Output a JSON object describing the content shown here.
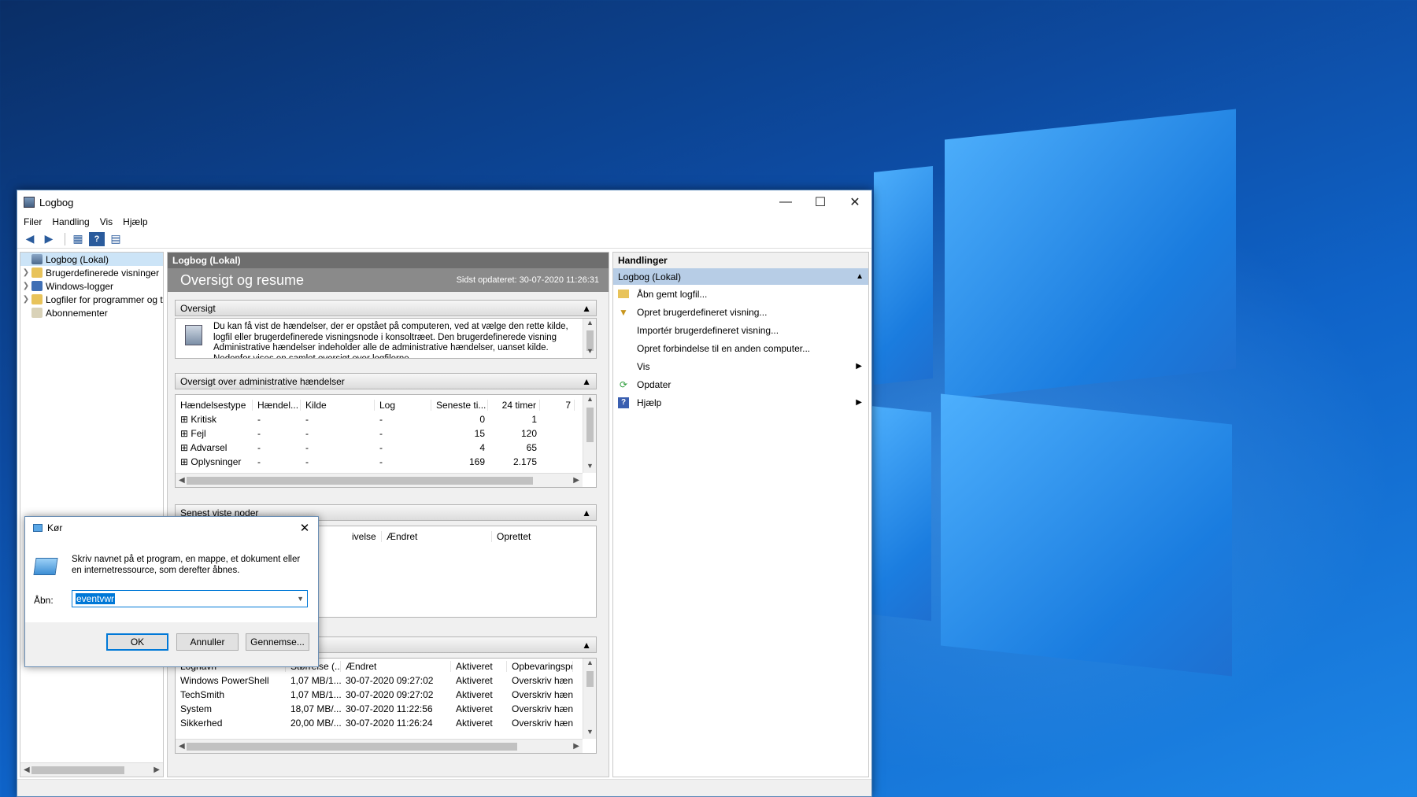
{
  "window": {
    "title": "Logbog",
    "menu": [
      "Filer",
      "Handling",
      "Vis",
      "Hjælp"
    ]
  },
  "tree": {
    "items": [
      {
        "label": "Logbog (Lokal)",
        "selected": true
      },
      {
        "label": "Brugerdefinerede visninger"
      },
      {
        "label": "Windows-logger"
      },
      {
        "label": "Logfiler for programmer og t"
      },
      {
        "label": "Abonnementer"
      }
    ]
  },
  "center": {
    "header": "Logbog (Lokal)",
    "title": "Oversigt og resume",
    "updated": "Sidst opdateret: 30-07-2020 11:26:31",
    "overview": {
      "label": "Oversigt",
      "text": "Du kan få vist de hændelser, der er opstået på computeren, ved at vælge den rette kilde, logfil eller brugerdefinerede visningsnode i konsoltræet. Den brugerdefinerede visning Administrative hændelser indeholder alle de administrative hændelser, uanset kilde. Nedenfor vises en samlet oversigt over logfilerne."
    },
    "admin_events": {
      "label": "Oversigt over administrative hændelser",
      "columns": [
        "Hændelsestype",
        "Hændel...",
        "Kilde",
        "Log",
        "Seneste ti...",
        "24 timer",
        "7"
      ],
      "rows": [
        [
          "Kritisk",
          "-",
          "-",
          "-",
          "0",
          "1"
        ],
        [
          "Fejl",
          "-",
          "-",
          "-",
          "15",
          "120"
        ],
        [
          "Advarsel",
          "-",
          "-",
          "-",
          "4",
          "65"
        ],
        [
          "Oplysninger",
          "-",
          "-",
          "-",
          "169",
          "2.175"
        ]
      ]
    },
    "recent": {
      "label": "Senest viste noder",
      "columns": [
        "ivelse",
        "Ændret",
        "Oprettet"
      ]
    },
    "logs": {
      "columns": [
        "Lognavn",
        "Størrelse (...",
        "Ændret",
        "Aktiveret",
        "Opbevaringspo"
      ],
      "rows": [
        [
          "Windows PowerShell",
          "1,07 MB/1...",
          "30-07-2020 09:27:02",
          "Aktiveret",
          "Overskriv hænd"
        ],
        [
          "TechSmith",
          "1,07 MB/1...",
          "30-07-2020 09:27:02",
          "Aktiveret",
          "Overskriv hænd"
        ],
        [
          "System",
          "18,07 MB/...",
          "30-07-2020 11:22:56",
          "Aktiveret",
          "Overskriv hænd"
        ],
        [
          "Sikkerhed",
          "20,00 MB/...",
          "30-07-2020 11:26:24",
          "Aktiveret",
          "Overskriv hænd"
        ]
      ]
    }
  },
  "actions": {
    "header": "Handlinger",
    "sub": "Logbog (Lokal)",
    "items": [
      {
        "label": "Åbn gemt logfil...",
        "icon": "folder-icon"
      },
      {
        "label": "Opret brugerdefineret visning...",
        "icon": "filter-icon"
      },
      {
        "label": "Importér brugerdefineret visning..."
      },
      {
        "label": "Opret forbindelse til en anden computer..."
      },
      {
        "label": "Vis",
        "submenu": true
      },
      {
        "label": "Opdater",
        "icon": "refresh-icon"
      },
      {
        "label": "Hjælp",
        "icon": "help-icon",
        "submenu": true
      }
    ]
  },
  "run": {
    "title": "Kør",
    "description": "Skriv navnet på et program, en mappe, et dokument eller en internetressource, som derefter åbnes.",
    "label": "Åbn:",
    "value": "eventvwr",
    "ok": "OK",
    "cancel": "Annuller",
    "browse": "Gennemse..."
  },
  "colors": {
    "accent": "#0078d7",
    "selection": "#cce4f7",
    "actions_sub": "#b7cde6",
    "panel_header": "#6e6e6e"
  }
}
